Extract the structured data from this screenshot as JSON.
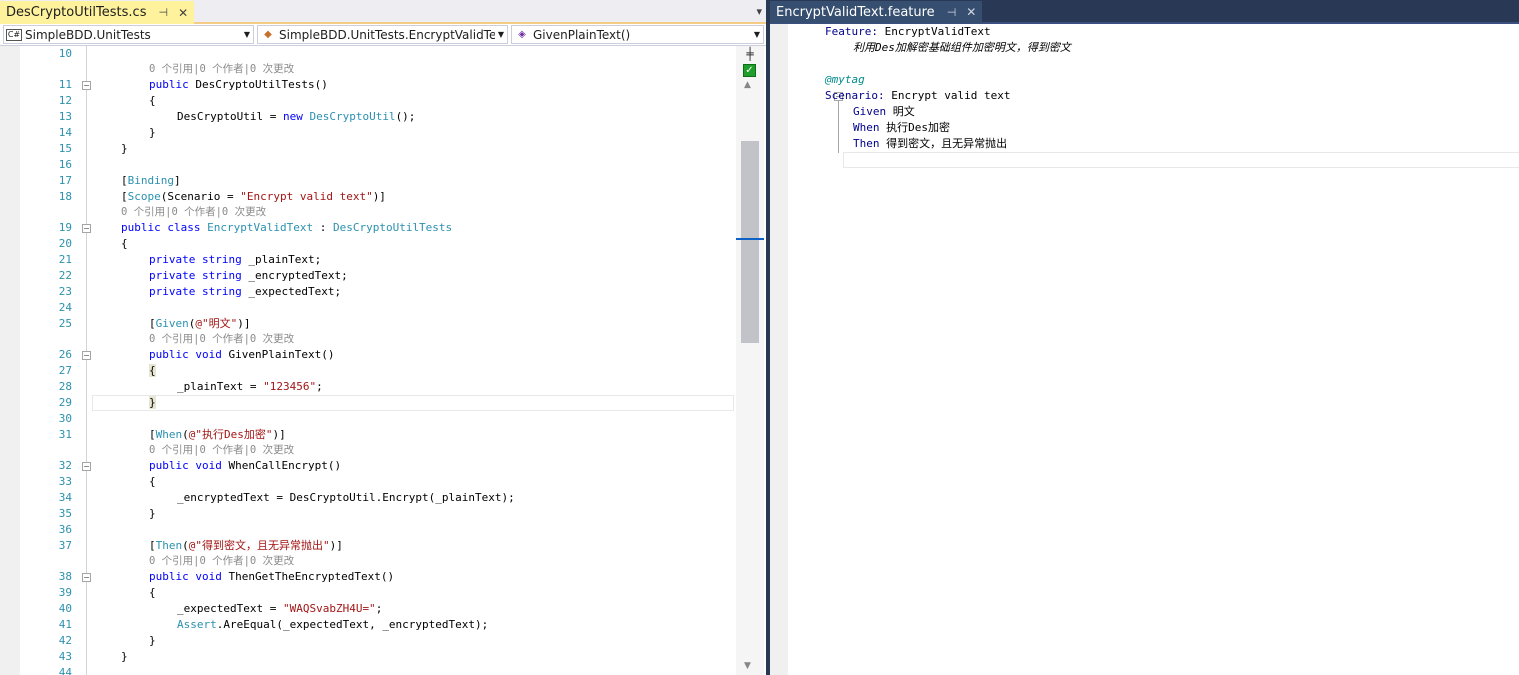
{
  "left_tab": {
    "title": "DesCryptoUtilTests.cs",
    "pin": "⊣",
    "close": "✕"
  },
  "overflow": "▾",
  "navbar": {
    "project": {
      "icon": "C#",
      "text": "SimpleBDD.UnitTests"
    },
    "type": {
      "text": "SimpleBDD.UnitTests.EncryptValidTex"
    },
    "member": {
      "text": "GivenPlainText()"
    }
  },
  "code": {
    "line_numbers": [
      "10",
      "11",
      "12",
      "13",
      "14",
      "15",
      "16",
      "17",
      "18",
      "19",
      "20",
      "21",
      "22",
      "23",
      "24",
      "25",
      "26",
      "27",
      "28",
      "29",
      "30",
      "31",
      "32",
      "33",
      "34",
      "35",
      "36",
      "37",
      "38",
      "39",
      "40",
      "41",
      "42",
      "43",
      "44"
    ],
    "lens": "0 个引用|0 个作者|0 次更改",
    "t_public": "public",
    "t_private": "private",
    "t_void": "void",
    "t_new": "new",
    "t_class": "class",
    "t_string": "string",
    "ctor_name": " DesCryptoUtilTests()",
    "l12": "{",
    "l13a": "DesCryptoUtil = ",
    "l13b": " DesCryptoUtil",
    "l13c": "();",
    "l14": "}",
    "l15": "}",
    "l17a": "[",
    "l17b": "Binding",
    "l17c": "]",
    "l18a": "[",
    "l18b": "Scope",
    "l18c": "(Scenario = ",
    "l18d": "\"Encrypt valid text\"",
    "l18e": ")]",
    "l19a": " EncryptValidText",
    "l19b": " : ",
    "l19c": "DesCryptoUtilTests",
    "l20": "{",
    "l21": " _plainText;",
    "l22": " _encryptedText;",
    "l23": " _expectedText;",
    "l25a": "[",
    "l25b": "Given",
    "l25c": "(",
    "l25d": "@\"明文\"",
    "l25e": ")]",
    "l26": " GivenPlainText()",
    "l27": "{",
    "l28a": "_plainText = ",
    "l28b": "\"123456\"",
    "l28c": ";",
    "l29": "}",
    "l31a": "[",
    "l31b": "When",
    "l31c": "(",
    "l31d": "@\"执行Des加密\"",
    "l31e": ")]",
    "l32": " WhenCallEncrypt()",
    "l33": "{",
    "l34": "_encryptedText = DesCryptoUtil.Encrypt(_plainText);",
    "l35": "}",
    "l37a": "[",
    "l37b": "Then",
    "l37c": "(",
    "l37d": "@\"得到密文，且无异常抛出\"",
    "l37e": ")]",
    "l38": " ThenGetTheEncryptedText()",
    "l39": "{",
    "l40a": "_expectedText = ",
    "l40b": "\"WAQSvabZH4U=\"",
    "l40c": ";",
    "l41a": "Assert",
    "l41b": ".AreEqual(_expectedText, _encryptedText);",
    "l42": "}",
    "l43": "}"
  },
  "scroll": {
    "split": "╪",
    "check": "✓",
    "up": "▲",
    "down": "▼"
  },
  "right_tab": {
    "title": "EncryptValidText.feature",
    "pin": "⊣",
    "close": "✕"
  },
  "feature": {
    "feature_kw": "Feature:",
    "feature_name": " EncryptValidText",
    "description": "利用Des加解密基础组件加密明文，得到密文",
    "tag": "@mytag",
    "scenario_kw": "Scenario:",
    "scenario_name": " Encrypt valid text",
    "given_kw": "Given",
    "given_text": " 明文",
    "when_kw": "When",
    "when_text": " 执行Des加密",
    "then_kw": "Then",
    "then_text": " 得到密文，且无异常抛出"
  },
  "fold_minus": "−"
}
